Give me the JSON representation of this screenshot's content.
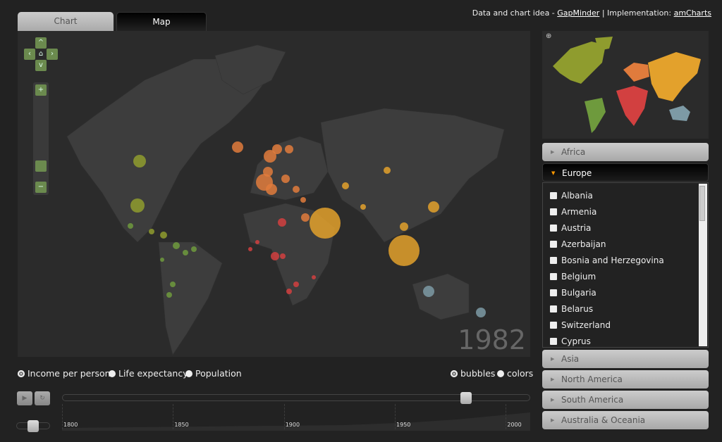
{
  "tabs": [
    {
      "label": "Chart",
      "active": false
    },
    {
      "label": "Map",
      "active": true
    }
  ],
  "credits": {
    "prefix": "Data and chart idea - ",
    "link1": "GapMinder",
    "sep": " | Implementation: ",
    "link2": "amCharts"
  },
  "map": {
    "year": "1982",
    "nav_icons": [
      "chevron-up-icon",
      "chevron-left-icon",
      "home-icon",
      "chevron-right-icon",
      "chevron-down-icon"
    ],
    "zoom_in": "+",
    "zoom_out": "−"
  },
  "measures": [
    {
      "label": "Income per person",
      "selected": true
    },
    {
      "label": "Life expectancy",
      "selected": false
    },
    {
      "label": "Population",
      "selected": false
    }
  ],
  "display": [
    {
      "label": "bubbles",
      "selected": true
    },
    {
      "label": "colors",
      "selected": false
    }
  ],
  "timeline": {
    "ticks": [
      "1800",
      "1850",
      "1900",
      "1950",
      "2000"
    ],
    "min": 1800,
    "max": 2011,
    "value": 1982,
    "play_icon": "play-icon",
    "loop_icon": "loop-icon",
    "speed": 0.5
  },
  "regions": [
    {
      "label": "Africa",
      "open": false,
      "color": "#d24040"
    },
    {
      "label": "Europe",
      "open": true,
      "color": "#e07b3c"
    },
    {
      "label": "Asia",
      "open": false,
      "color": "#e3a12c"
    },
    {
      "label": "North America",
      "open": false,
      "color": "#8f9c2e"
    },
    {
      "label": "South America",
      "open": false,
      "color": "#6e9a3d"
    },
    {
      "label": "Australia & Oceania",
      "open": false,
      "color": "#7d9aa5"
    }
  ],
  "europe_countries": [
    "Albania",
    "Armenia",
    "Austria",
    "Azerbaijan",
    "Bosnia and Herzegovina",
    "Belgium",
    "Bulgaria",
    "Belarus",
    "Switzerland",
    "Cyprus"
  ]
}
